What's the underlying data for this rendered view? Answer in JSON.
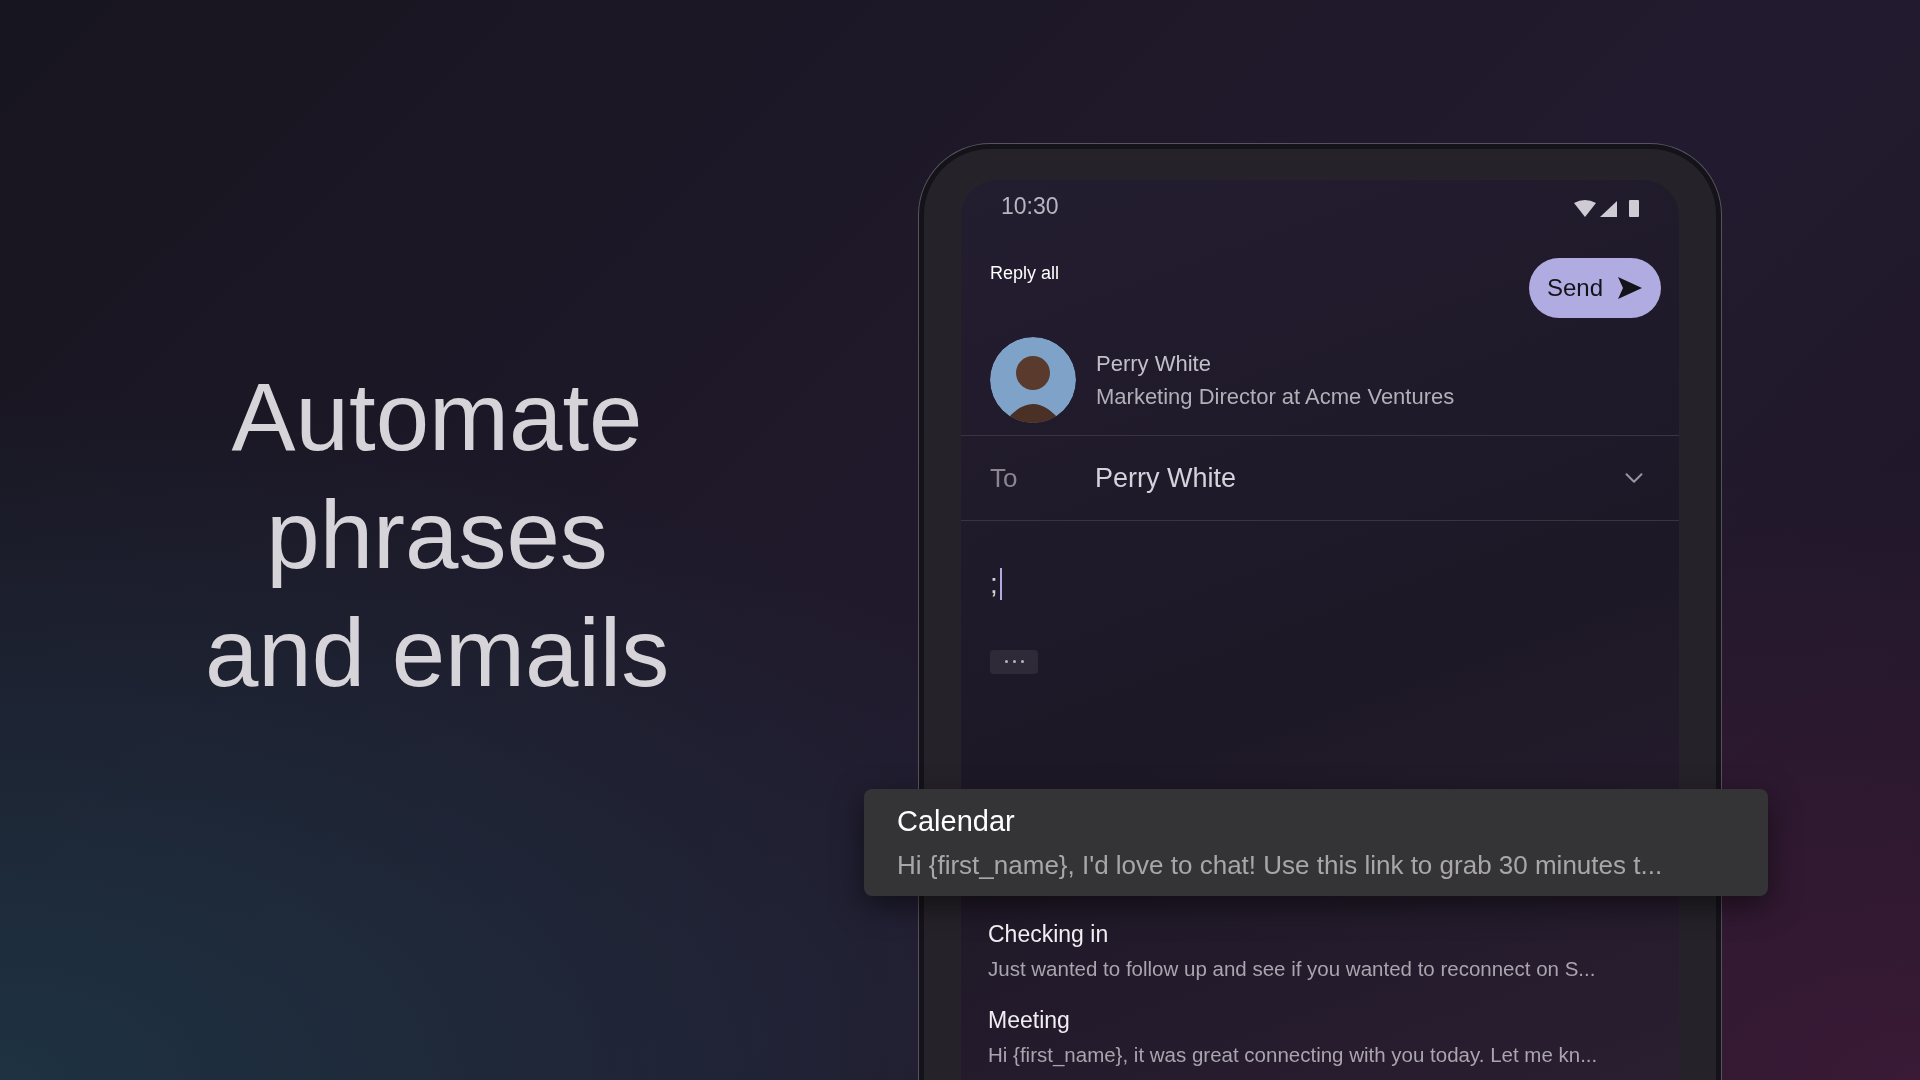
{
  "headline": "Automate phrases and emails",
  "status_bar": {
    "time": "10:30"
  },
  "header": {
    "title": "Reply all",
    "send_button": "Send"
  },
  "sender": {
    "name": "Perry White",
    "title": "Marketing Director at Acme Ventures"
  },
  "to_field": {
    "label": "To",
    "value": "Perry White",
    "expanded": false
  },
  "body": {
    "value": ";"
  },
  "suggestions": [
    {
      "title": "Calendar",
      "preview": "Hi {first_name}, I'd love to chat! Use this link to grab 30 minutes t...",
      "selected": true
    },
    {
      "title": "Checking in",
      "preview": "Just wanted to follow up and see if you wanted to reconnect on S...",
      "selected": false
    },
    {
      "title": "Meeting",
      "preview": "Hi {first_name}, it was great connecting with you today. Let me kn...",
      "selected": false
    }
  ]
}
